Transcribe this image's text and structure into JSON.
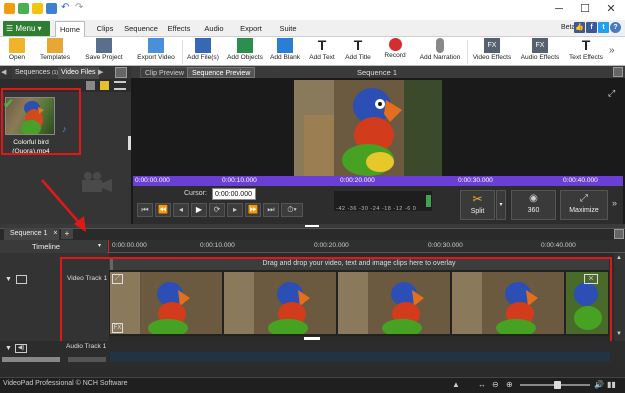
{
  "titlebar": {
    "min": "─",
    "max": "☐",
    "close": "✕"
  },
  "menu": {
    "label": "Menu",
    "tabs": [
      "Home",
      "Clips",
      "Sequence",
      "Effects",
      "Audio",
      "Export",
      "Suite"
    ],
    "beta": "Beta"
  },
  "toolbar": {
    "open": "Open",
    "templates": "Templates",
    "save_project": "Save Project",
    "export_video": "Export Video",
    "add_files": "Add File(s)",
    "add_objects": "Add Objects",
    "add_blank": "Add Blank",
    "add_text": "Add Text",
    "add_title": "Add Title",
    "record": "Record",
    "add_narration": "Add Narration",
    "video_effects": "Video Effects",
    "audio_effects": "Audio Effects",
    "text_effects": "Text Effects"
  },
  "bin": {
    "tab_sequences": "Sequences",
    "tab_sequences_count": "(1)",
    "tab_video_files": "Video Files",
    "clip_name": "Colorful bird (Quora).mp4"
  },
  "preview": {
    "tab_clip": "Clip Preview",
    "tab_sequence": "Sequence Preview",
    "title": "Sequence 1",
    "ticks": [
      "0:00:00.000",
      "0:00:10.000",
      "0:00:20.000",
      "0:00:30.000",
      "0:00:40.000"
    ],
    "cursor_label": "Cursor:",
    "cursor_value": "0:00:00.000",
    "meter_scale": "-42 -36 -30 -24 -18 -12 -6 0",
    "split": "Split",
    "btn360": "360",
    "maximize": "Maximize"
  },
  "timeline": {
    "seq_tab": "Sequence 1",
    "close": "×",
    "add": "+",
    "header": "Timeline",
    "ticks": [
      "0:00:00.000",
      "0:00:10.000",
      "0:00:20.000",
      "0:00:30.000",
      "0:00:40.000"
    ],
    "drop_hint": "Drag and drop your video, text and image clips here to overlay",
    "video_track": "Video Track 1",
    "audio_track": "Audio Track 1"
  },
  "status": {
    "text": "VideoPad Professional © NCH Software"
  },
  "colors": {
    "accent": "#2e7d32",
    "ruler": "#6c3fd4",
    "highlight": "#e01818"
  }
}
